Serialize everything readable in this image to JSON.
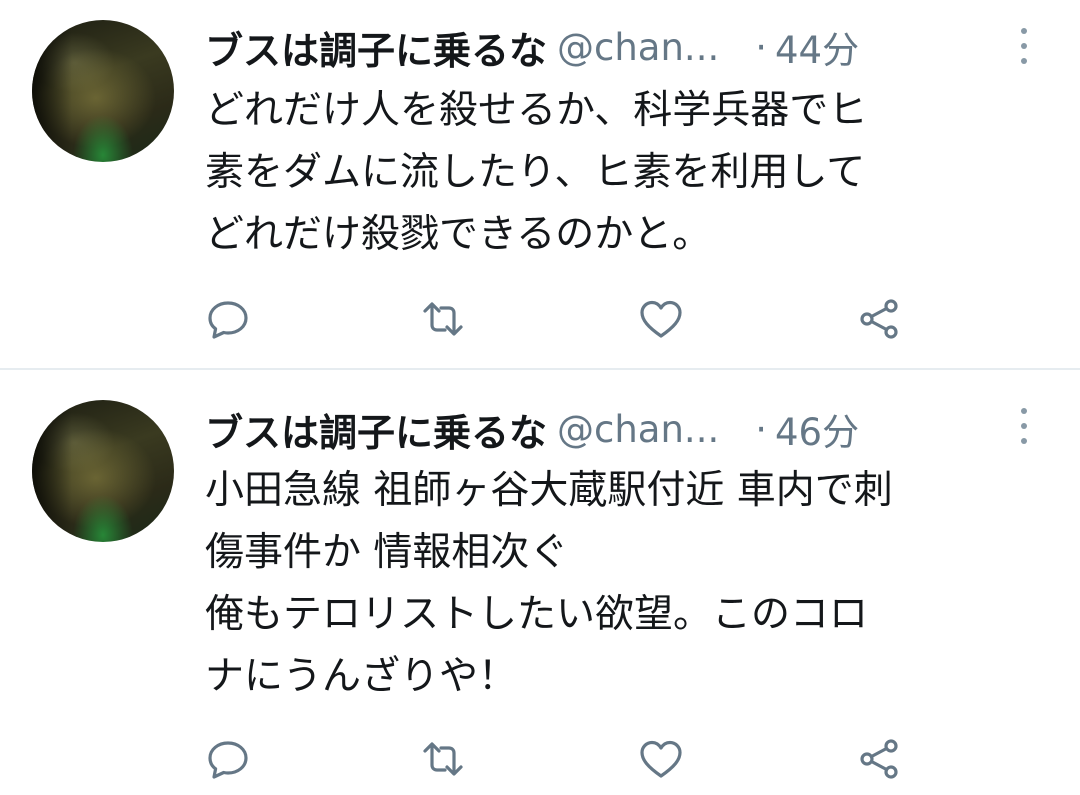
{
  "tweets": [
    {
      "display_name": "ブスは調子に乗るな",
      "handle": "@chan...",
      "separator": "·",
      "time": "44分",
      "lines": [
        "どれだけ人を殺せるか、科学兵器でヒ",
        "素をダムに流したり、ヒ素を利用して",
        "どれだけ殺戮できるのかと。"
      ]
    },
    {
      "display_name": "ブスは調子に乗るな",
      "handle": "@chan...",
      "separator": "·",
      "time": "46分",
      "lines": [
        "小田急線 祖師ヶ谷大蔵駅付近 車内で刺",
        "傷事件か 情報相次ぐ",
        "俺もテロリストしたい欲望。このコロ",
        "ナにうんざりや！"
      ]
    }
  ],
  "icons": {
    "more": "more-vertical-icon",
    "reply": "reply-icon",
    "retweet": "retweet-icon",
    "like": "heart-icon",
    "share": "share-icon"
  },
  "colors": {
    "text": "#14171a",
    "secondary": "#657786",
    "icon": "#657786",
    "divider": "#e6ecf0"
  }
}
